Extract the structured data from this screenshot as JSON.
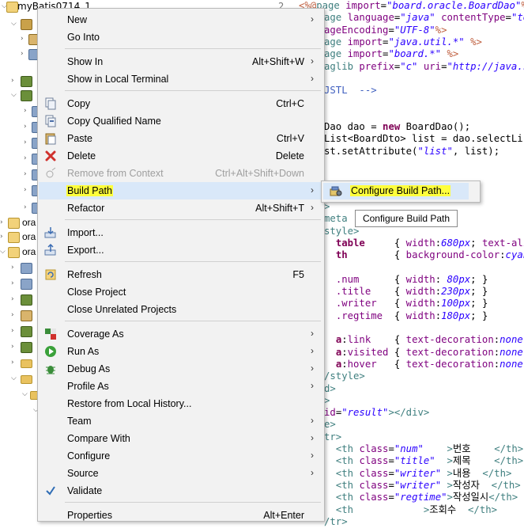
{
  "tree": {
    "project_name": "myBatis0714_1",
    "others": [
      "ora",
      "ora",
      "ora"
    ]
  },
  "editor": {
    "line_number": "2",
    "lines": [
      {
        "parts": [
          [
            "d",
            "<%@"
          ],
          [
            "t",
            "page "
          ],
          [
            "a",
            "import"
          ],
          [
            "",
            "="
          ],
          [
            "s",
            "\"board.oracle.BoardDao\""
          ],
          [
            "d",
            "%>"
          ]
        ]
      },
      {
        "parts": [
          [
            "t",
            "age "
          ],
          [
            "a",
            "language"
          ],
          [
            "",
            "="
          ],
          [
            "s",
            "\"java\""
          ],
          [
            "",
            " "
          ],
          [
            "a",
            "contentType"
          ],
          [
            "",
            "="
          ],
          [
            "s",
            "\"tex"
          ]
        ]
      },
      {
        "parts": [
          [
            "a",
            "ageEncoding"
          ],
          [
            "",
            "="
          ],
          [
            "s",
            "\"UTF-8\""
          ],
          [
            "d",
            "%>"
          ]
        ]
      },
      {
        "parts": [
          [
            "t",
            "age "
          ],
          [
            "a",
            "import"
          ],
          [
            "",
            "="
          ],
          [
            "s",
            "\"java.util.*\""
          ],
          [
            "",
            " "
          ],
          [
            "d",
            "%>"
          ]
        ]
      },
      {
        "parts": [
          [
            "t",
            "age "
          ],
          [
            "a",
            "import"
          ],
          [
            "",
            "="
          ],
          [
            "s",
            "\"board.*\""
          ],
          [
            "",
            " "
          ],
          [
            "d",
            "%>"
          ]
        ]
      },
      {
        "parts": [
          [
            "t",
            "aglib "
          ],
          [
            "a",
            "prefix"
          ],
          [
            "",
            "="
          ],
          [
            "s",
            "\"c\""
          ],
          [
            "",
            " "
          ],
          [
            "a",
            "uri"
          ],
          [
            "",
            "="
          ],
          [
            "s",
            "\"http://java.su"
          ]
        ]
      },
      {
        "parts": [
          [
            "",
            ""
          ]
        ]
      },
      {
        "parts": [
          [
            "c",
            "JSTL  -->"
          ]
        ]
      },
      {
        "parts": [
          [
            "",
            ""
          ]
        ]
      },
      {
        "parts": [
          [
            "",
            ""
          ]
        ]
      },
      {
        "parts": [
          [
            "",
            "Dao dao = "
          ],
          [
            "k",
            "new"
          ],
          [
            "",
            " BoardDao();"
          ]
        ]
      },
      {
        "parts": [
          [
            "",
            "List<BoardDto> list = dao.selectList"
          ]
        ]
      },
      {
        "parts": [
          [
            "",
            "st.setAttribute("
          ],
          [
            "s",
            "\"list\""
          ],
          [
            "",
            ", list);"
          ]
        ]
      }
    ],
    "lines_bottom": [
      {
        "parts": [
          [
            "t",
            ">"
          ]
        ]
      },
      {
        "parts": [
          [
            "t",
            "meta "
          ]
        ]
      },
      {
        "parts": [
          [
            "t",
            "style>"
          ]
        ]
      },
      {
        "parts": [
          [
            "",
            ""
          ],
          [
            "",
            "  "
          ],
          [
            "k",
            "table"
          ],
          [
            "",
            "     { "
          ],
          [
            "cssp",
            "width"
          ],
          [
            "",
            ":"
          ],
          [
            "cssv",
            "680px"
          ],
          [
            "",
            "; "
          ],
          [
            "cssp",
            "text-ali"
          ]
        ]
      },
      {
        "parts": [
          [
            "",
            "  "
          ],
          [
            "k",
            "th"
          ],
          [
            "",
            "        { "
          ],
          [
            "cssp",
            "background-color"
          ],
          [
            "",
            ":"
          ],
          [
            "cssv",
            "cyan"
          ]
        ]
      },
      {
        "parts": [
          [
            "",
            ""
          ]
        ]
      },
      {
        "parts": [
          [
            "",
            "  "
          ],
          [
            "a",
            ".num"
          ],
          [
            "",
            "      { "
          ],
          [
            "cssp",
            "width"
          ],
          [
            "",
            ": "
          ],
          [
            "cssv",
            "80px"
          ],
          [
            "",
            "; }"
          ]
        ]
      },
      {
        "parts": [
          [
            "",
            "  "
          ],
          [
            "a",
            ".title"
          ],
          [
            "",
            "    { "
          ],
          [
            "cssp",
            "width"
          ],
          [
            "",
            ":"
          ],
          [
            "cssv",
            "230px"
          ],
          [
            "",
            "; }"
          ]
        ]
      },
      {
        "parts": [
          [
            "",
            "  "
          ],
          [
            "a",
            ".writer"
          ],
          [
            "",
            "   { "
          ],
          [
            "cssp",
            "width"
          ],
          [
            "",
            ":"
          ],
          [
            "cssv",
            "100px"
          ],
          [
            "",
            "; }"
          ]
        ]
      },
      {
        "parts": [
          [
            "",
            "  "
          ],
          [
            "a",
            ".regtime"
          ],
          [
            "",
            "  { "
          ],
          [
            "cssp",
            "width"
          ],
          [
            "",
            ":"
          ],
          [
            "cssv",
            "180px"
          ],
          [
            "",
            "; }"
          ]
        ]
      },
      {
        "parts": [
          [
            "",
            ""
          ]
        ]
      },
      {
        "parts": [
          [
            "",
            "  "
          ],
          [
            "k",
            "a"
          ],
          [
            "",
            ":"
          ],
          [
            "a",
            "link"
          ],
          [
            "",
            "    { "
          ],
          [
            "cssp",
            "text-decoration"
          ],
          [
            "",
            ":"
          ],
          [
            "cssv",
            "none"
          ],
          [
            "",
            ";"
          ]
        ]
      },
      {
        "parts": [
          [
            "",
            "  "
          ],
          [
            "k",
            "a"
          ],
          [
            "",
            ":"
          ],
          [
            "a",
            "visited"
          ],
          [
            "",
            " { "
          ],
          [
            "cssp",
            "text-decoration"
          ],
          [
            "",
            ":"
          ],
          [
            "cssv",
            "none"
          ],
          [
            "",
            ";"
          ]
        ]
      },
      {
        "parts": [
          [
            "",
            "  "
          ],
          [
            "k",
            "a"
          ],
          [
            "",
            ":"
          ],
          [
            "a",
            "hover"
          ],
          [
            "",
            "   { "
          ],
          [
            "cssp",
            "text-decoration"
          ],
          [
            "",
            ":"
          ],
          [
            "cssv",
            "none"
          ],
          [
            "",
            ";"
          ]
        ]
      },
      {
        "parts": [
          [
            "t",
            "/style>"
          ]
        ]
      },
      {
        "parts": [
          [
            "t",
            "d>"
          ]
        ]
      },
      {
        "parts": [
          [
            "t",
            ">"
          ]
        ]
      },
      {
        "parts": [
          [
            "a",
            "id"
          ],
          [
            "",
            "="
          ],
          [
            "s",
            "\"result\""
          ],
          [
            "t",
            "></div>"
          ]
        ]
      },
      {
        "parts": [
          [
            "t",
            "e>"
          ]
        ]
      },
      {
        "parts": [
          [
            "t",
            "tr>"
          ]
        ]
      },
      {
        "parts": [
          [
            "",
            "  "
          ],
          [
            "t",
            "<th "
          ],
          [
            "a",
            "class"
          ],
          [
            "",
            "="
          ],
          [
            "s",
            "\"num\""
          ],
          [
            "",
            "    "
          ],
          [
            "t",
            ">"
          ],
          [
            "",
            "번호    "
          ],
          [
            "t",
            "</th>"
          ]
        ]
      },
      {
        "parts": [
          [
            "",
            "  "
          ],
          [
            "t",
            "<th "
          ],
          [
            "a",
            "class"
          ],
          [
            "",
            "="
          ],
          [
            "s",
            "\"title\""
          ],
          [
            "",
            "  "
          ],
          [
            "t",
            ">"
          ],
          [
            "",
            "제목    "
          ],
          [
            "t",
            "</th>"
          ]
        ]
      },
      {
        "parts": [
          [
            "",
            "  "
          ],
          [
            "t",
            "<th "
          ],
          [
            "a",
            "class"
          ],
          [
            "",
            "="
          ],
          [
            "s",
            "\"writer\""
          ],
          [
            "",
            " "
          ],
          [
            "t",
            ">"
          ],
          [
            "",
            "내용  "
          ],
          [
            "t",
            "</th>"
          ]
        ]
      },
      {
        "parts": [
          [
            "",
            "  "
          ],
          [
            "t",
            "<th "
          ],
          [
            "a",
            "class"
          ],
          [
            "",
            "="
          ],
          [
            "s",
            "\"writer\""
          ],
          [
            "",
            " "
          ],
          [
            "t",
            ">"
          ],
          [
            "",
            "작성자  "
          ],
          [
            "t",
            "</th>"
          ]
        ]
      },
      {
        "parts": [
          [
            "",
            "  "
          ],
          [
            "t",
            "<th "
          ],
          [
            "a",
            "class"
          ],
          [
            "",
            "="
          ],
          [
            "s",
            "\"regtime\""
          ],
          [
            "t",
            ">"
          ],
          [
            "",
            "작성일시"
          ],
          [
            "t",
            "</th>"
          ]
        ]
      },
      {
        "parts": [
          [
            "",
            "  "
          ],
          [
            "t",
            "<th"
          ],
          [
            "",
            "            "
          ],
          [
            "t",
            ">"
          ],
          [
            "",
            "조회수  "
          ],
          [
            "t",
            "</th>"
          ]
        ]
      },
      {
        "parts": [
          [
            "t",
            "/tr>"
          ]
        ]
      }
    ]
  },
  "menu": {
    "items": [
      {
        "label": "New",
        "shortcut": "",
        "submenu": true,
        "icon": "none"
      },
      {
        "label": "Go Into",
        "shortcut": "",
        "submenu": false,
        "icon": "none"
      },
      {
        "sep": true
      },
      {
        "label": "Show In",
        "shortcut": "Alt+Shift+W",
        "submenu": true,
        "icon": "none"
      },
      {
        "label": "Show in Local Terminal",
        "shortcut": "",
        "submenu": true,
        "icon": "none"
      },
      {
        "sep": true
      },
      {
        "label": "Copy",
        "shortcut": "Ctrl+C",
        "submenu": false,
        "icon": "copy-icon"
      },
      {
        "label": "Copy Qualified Name",
        "shortcut": "",
        "submenu": false,
        "icon": "copy-qualified-icon"
      },
      {
        "label": "Paste",
        "shortcut": "Ctrl+V",
        "submenu": false,
        "icon": "paste-icon"
      },
      {
        "label": "Delete",
        "shortcut": "Delete",
        "submenu": false,
        "icon": "delete-icon"
      },
      {
        "label": "Remove from Context",
        "shortcut": "Ctrl+Alt+Shift+Down",
        "submenu": false,
        "icon": "remove-context-icon",
        "disabled": true
      },
      {
        "label": "Build Path",
        "shortcut": "",
        "submenu": true,
        "icon": "none",
        "highlight": true
      },
      {
        "label": "Refactor",
        "shortcut": "Alt+Shift+T",
        "submenu": true,
        "icon": "none"
      },
      {
        "sep": true
      },
      {
        "label": "Import...",
        "shortcut": "",
        "submenu": false,
        "icon": "import-icon"
      },
      {
        "label": "Export...",
        "shortcut": "",
        "submenu": false,
        "icon": "export-icon"
      },
      {
        "sep": true
      },
      {
        "label": "Refresh",
        "shortcut": "F5",
        "submenu": false,
        "icon": "refresh-icon"
      },
      {
        "label": "Close Project",
        "shortcut": "",
        "submenu": false,
        "icon": "none"
      },
      {
        "label": "Close Unrelated Projects",
        "shortcut": "",
        "submenu": false,
        "icon": "none"
      },
      {
        "sep": true
      },
      {
        "label": "Coverage As",
        "shortcut": "",
        "submenu": true,
        "icon": "coverage-icon"
      },
      {
        "label": "Run As",
        "shortcut": "",
        "submenu": true,
        "icon": "run-icon"
      },
      {
        "label": "Debug As",
        "shortcut": "",
        "submenu": true,
        "icon": "debug-icon"
      },
      {
        "label": "Profile As",
        "shortcut": "",
        "submenu": true,
        "icon": "none"
      },
      {
        "label": "Restore from Local History...",
        "shortcut": "",
        "submenu": false,
        "icon": "none"
      },
      {
        "label": "Team",
        "shortcut": "",
        "submenu": true,
        "icon": "none"
      },
      {
        "label": "Compare With",
        "shortcut": "",
        "submenu": true,
        "icon": "none"
      },
      {
        "label": "Configure",
        "shortcut": "",
        "submenu": true,
        "icon": "none"
      },
      {
        "label": "Source",
        "shortcut": "",
        "submenu": true,
        "icon": "none"
      },
      {
        "label": "Validate",
        "shortcut": "",
        "submenu": false,
        "icon": "validate-check-icon"
      },
      {
        "sep": true
      },
      {
        "label": "Properties",
        "shortcut": "Alt+Enter",
        "submenu": false,
        "icon": "none"
      }
    ]
  },
  "submenu": {
    "label": "Configure Build Path...",
    "icon": "configure-build-path-icon"
  },
  "tooltip": {
    "text": "Configure Build Path"
  },
  "colors": {
    "highlight_row": "#d9e8f9",
    "yellow_mark": "#ffff3c",
    "menu_bg": "#f2f2f2"
  }
}
